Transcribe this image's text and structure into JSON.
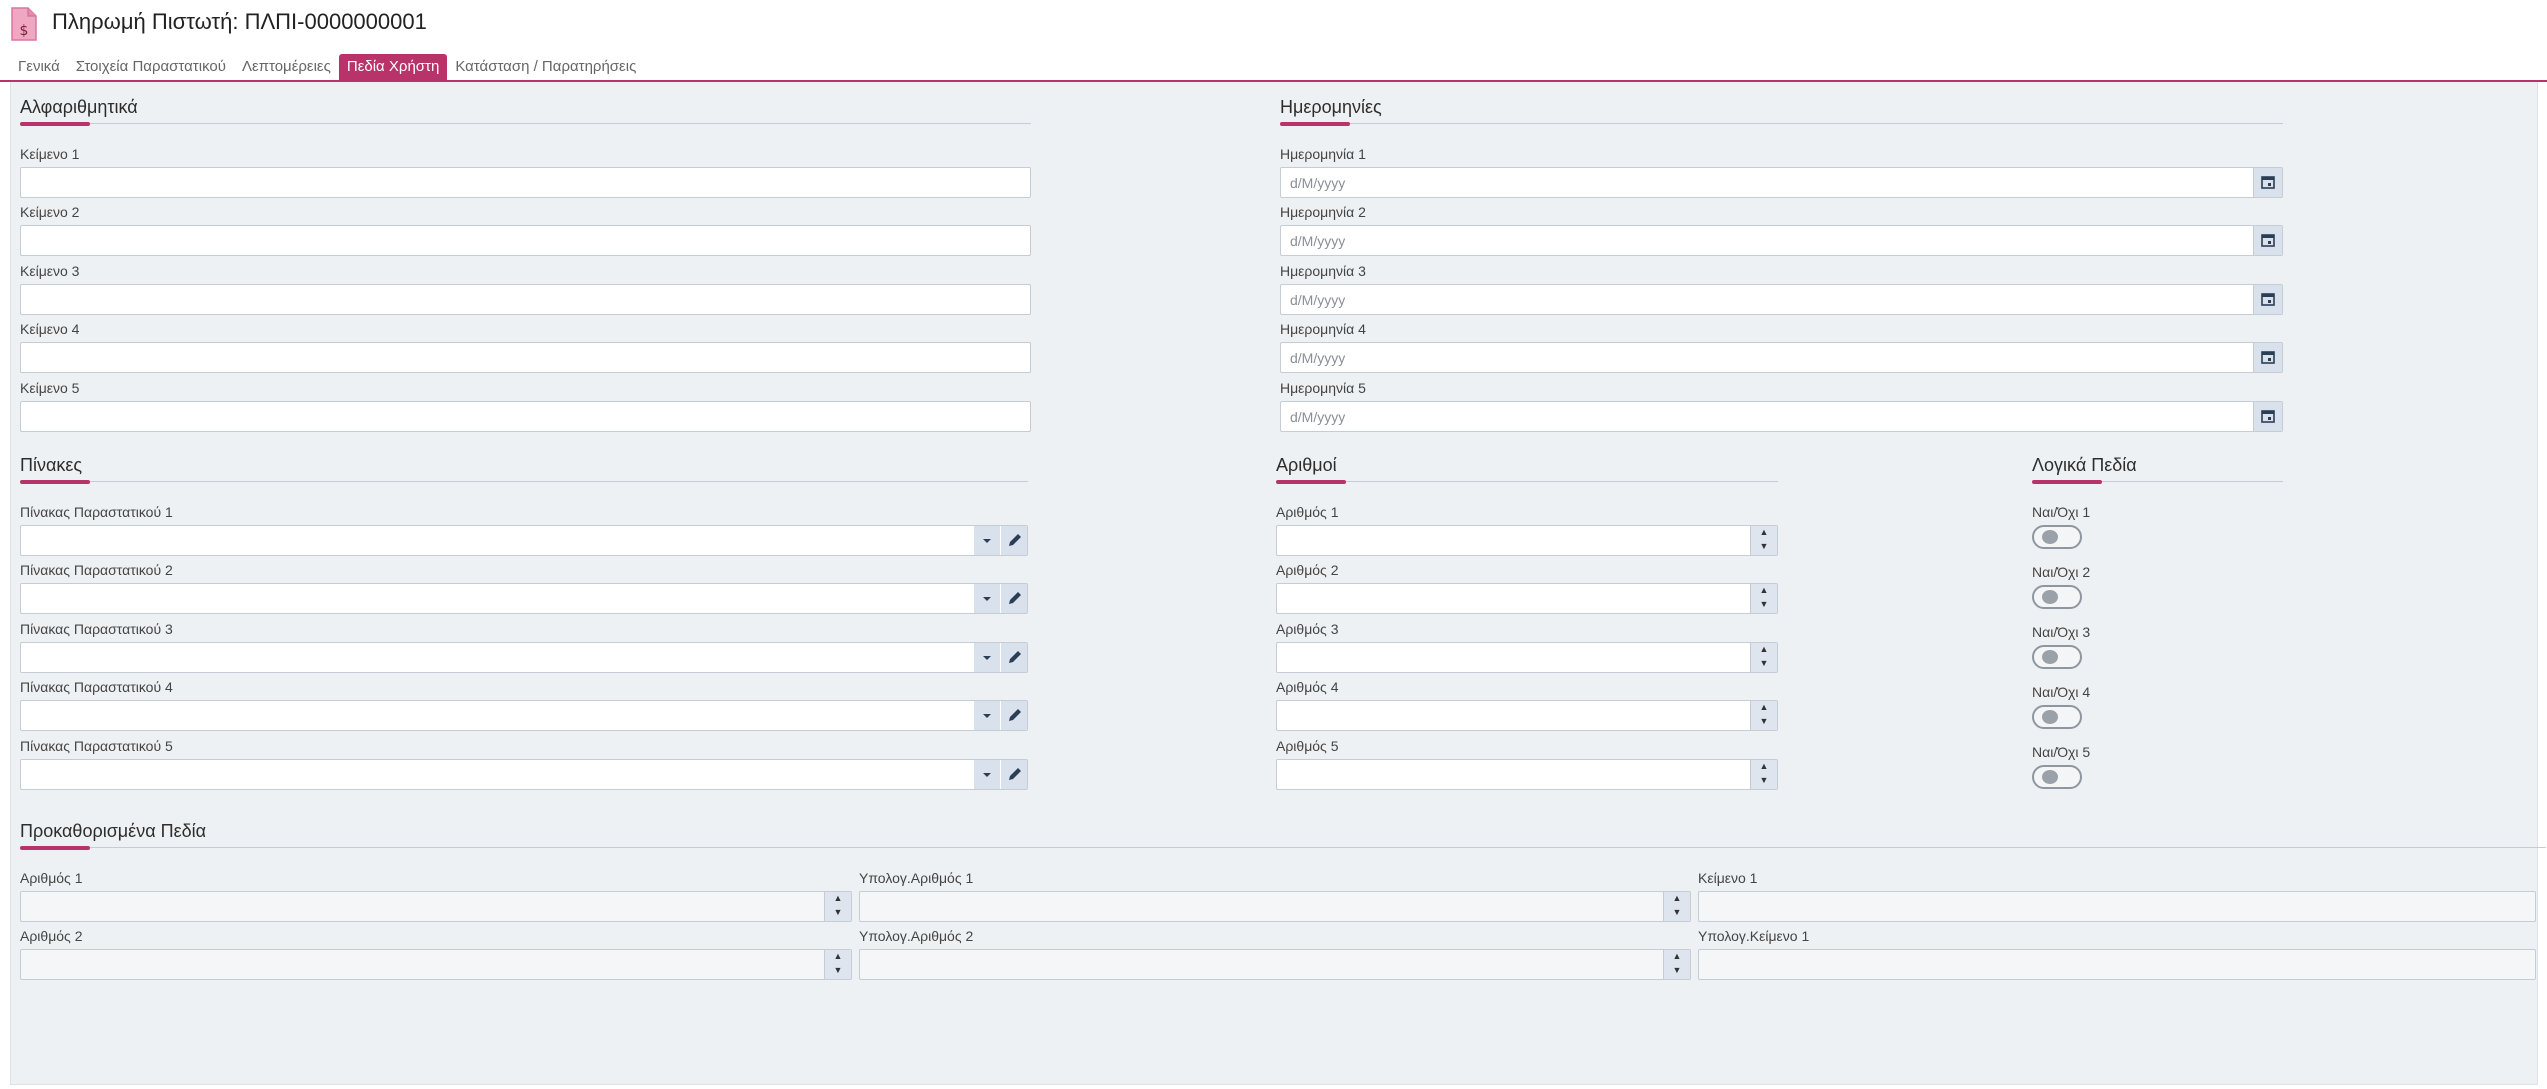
{
  "header": {
    "title": "Πληρωμή Πιστωτή: ΠΛΠΙ-0000000001",
    "icon": "document-dollar-icon"
  },
  "tabs": [
    {
      "label": "Γενικά"
    },
    {
      "label": "Στοιχεία Παραστατικού"
    },
    {
      "label": "Λεπτομέρειες"
    },
    {
      "label": "Πεδία Χρήστη",
      "active": true
    },
    {
      "label": "Κατάσταση / Παρατηρήσεις"
    }
  ],
  "colors": {
    "accent": "#b8336a",
    "panel": "#eef1f4",
    "button": "#d8e1ec"
  },
  "alpha": {
    "title": "Αλφαριθμητικά",
    "fields": [
      {
        "label": "Κείμενο 1",
        "value": ""
      },
      {
        "label": "Κείμενο 2",
        "value": ""
      },
      {
        "label": "Κείμενο 3",
        "value": ""
      },
      {
        "label": "Κείμενο 4",
        "value": ""
      },
      {
        "label": "Κείμενο 5",
        "value": ""
      }
    ]
  },
  "dates": {
    "title": "Ημερομηνίες",
    "fields": [
      {
        "label": "Ημερομηνία 1",
        "placeholder": "d/M/yyyy"
      },
      {
        "label": "Ημερομηνία 2",
        "placeholder": "d/M/yyyy"
      },
      {
        "label": "Ημερομηνία 3",
        "placeholder": "d/M/yyyy"
      },
      {
        "label": "Ημερομηνία 4",
        "placeholder": "d/M/yyyy"
      },
      {
        "label": "Ημερομηνία 5",
        "placeholder": "d/M/yyyy"
      }
    ]
  },
  "tables": {
    "title": "Πίνακες",
    "fields": [
      {
        "label": "Πίνακας Παραστατικού 1",
        "value": ""
      },
      {
        "label": "Πίνακας Παραστατικού 2",
        "value": ""
      },
      {
        "label": "Πίνακας Παραστατικού 3",
        "value": ""
      },
      {
        "label": "Πίνακας Παραστατικού 4",
        "value": ""
      },
      {
        "label": "Πίνακας Παραστατικού 5",
        "value": ""
      }
    ]
  },
  "numbers": {
    "title": "Αριθμοί",
    "fields": [
      {
        "label": "Αριθμός 1",
        "value": ""
      },
      {
        "label": "Αριθμός 2",
        "value": ""
      },
      {
        "label": "Αριθμός 3",
        "value": ""
      },
      {
        "label": "Αριθμός 4",
        "value": ""
      },
      {
        "label": "Αριθμός 5",
        "value": ""
      }
    ]
  },
  "logic": {
    "title": "Λογικά Πεδία",
    "fields": [
      {
        "label": "Ναι/Όχι 1",
        "on": false
      },
      {
        "label": "Ναι/Όχι 2",
        "on": false
      },
      {
        "label": "Ναι/Όχι 3",
        "on": false
      },
      {
        "label": "Ναι/Όχι 4",
        "on": false
      },
      {
        "label": "Ναι/Όχι 5",
        "on": false
      }
    ]
  },
  "predefined": {
    "title": "Προκαθορισμένα Πεδία",
    "fields": [
      {
        "label": "Αριθμός 1",
        "value": ""
      },
      {
        "label": "Υπολογ.Αριθμός 1",
        "value": ""
      },
      {
        "label": "Κείμενο 1",
        "value": ""
      },
      {
        "label": "Αριθμός 2",
        "value": ""
      },
      {
        "label": "Υπολογ.Αριθμός 2",
        "value": ""
      },
      {
        "label": "Υπολογ.Κείμενο 1",
        "value": ""
      }
    ]
  }
}
